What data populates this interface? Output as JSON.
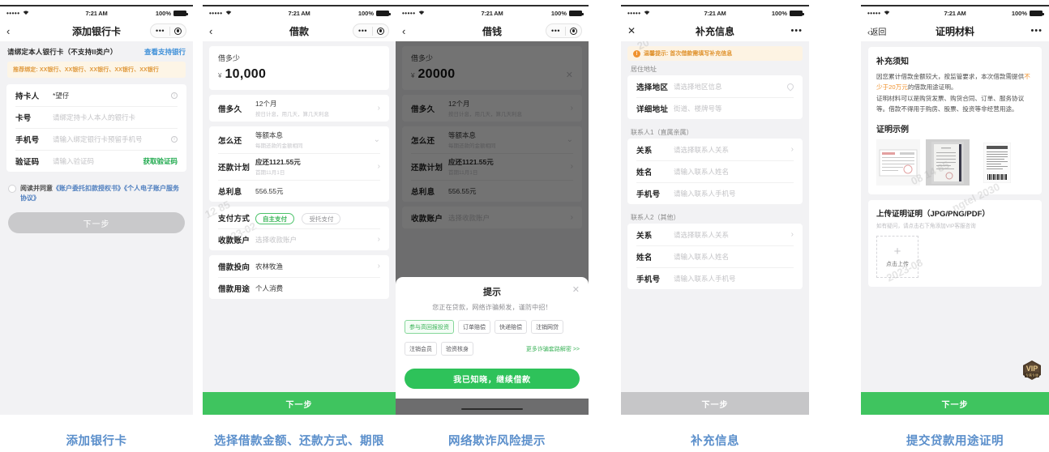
{
  "status_bar": {
    "signal": "•••••",
    "wifi": "◂",
    "time": "7:21 AM",
    "battery": "100%"
  },
  "captions": [
    "添加银行卡",
    "选择借款金额、还款方式、期限",
    "网络欺诈风险提示",
    "补充信息",
    "提交贷款用途证明"
  ],
  "panel1": {
    "nav": {
      "back": "‹",
      "title": "添加银行卡"
    },
    "hint": "请绑定本人银行卡（不支持II类户）",
    "hint_link": "查看支持银行",
    "banner": "推荐绑定: XX银行、XX银行、XX银行、XX银行、XX银行",
    "rows": [
      {
        "label": "持卡人",
        "value": "*望仔",
        "placeholder": false,
        "info": true
      },
      {
        "label": "卡号",
        "value": "请绑定持卡人本人的银行卡",
        "placeholder": true,
        "info": false
      },
      {
        "label": "手机号",
        "value": "请输入绑定银行卡预留手机号",
        "placeholder": true,
        "info": true
      },
      {
        "label": "验证码",
        "value": "请输入验证码",
        "placeholder": true,
        "action": "获取验证码"
      }
    ],
    "agree_prefix": "阅读并同意",
    "agree_link1": "《账户委托扣款授权书》",
    "agree_link2": "《个人电子账户服务协议》",
    "next_button": "下一步"
  },
  "panel2": {
    "nav": {
      "back": "‹",
      "title": "借款"
    },
    "amount_label": "借多少",
    "amount_currency": "¥",
    "amount_value": "10,000",
    "rows": [
      {
        "label": "借多久",
        "main": "12个月",
        "sub": "按日计息，用几天，算几天利息",
        "chev": "›"
      },
      {
        "label": "怎么还",
        "main": "等额本息",
        "sub": "每期还款的金额相同",
        "chev": "⌄"
      },
      {
        "label": "还款计划",
        "main": "应还1121.55元",
        "sub": "首期11月1日",
        "chev": "›",
        "bold": true
      },
      {
        "label": "总利息",
        "main": "556.55元",
        "sub": "",
        "chev": ""
      }
    ],
    "pay_label": "支付方式",
    "pay_options": [
      {
        "text": "自主支付",
        "selected": true
      },
      {
        "text": "受托支付",
        "selected": false
      }
    ],
    "account_label": "收款账户",
    "account_placeholder": "选择收款账户",
    "purpose_rows": [
      {
        "label": "借款投向",
        "value": "农林牧渔",
        "chev": "›"
      },
      {
        "label": "借款用途",
        "value": "个人消费",
        "chev": ""
      }
    ],
    "next_button": "下一步"
  },
  "panel3": {
    "nav": {
      "back": "‹",
      "title": "借钱"
    },
    "amount_label": "借多少",
    "amount_currency": "¥",
    "amount_value": "20000",
    "rows": [
      {
        "label": "借多久",
        "main": "12个月",
        "sub": "按日计息，用几天，算几天利息",
        "chev": "›"
      },
      {
        "label": "怎么还",
        "main": "等额本息",
        "sub": "每期还款的金额相同",
        "chev": "⌄"
      },
      {
        "label": "还款计划",
        "main": "应还1121.55元",
        "sub": "首期11月1日",
        "chev": "›",
        "bold": true
      },
      {
        "label": "总利息",
        "main": "556.55元",
        "sub": "",
        "chev": ""
      }
    ],
    "account_label": "收款账户",
    "account_placeholder": "选择收款账户",
    "modal": {
      "title": "提示",
      "close": "✕",
      "subtitle": "您正在贷款，网络诈骗频发，谨防中招！",
      "tags": [
        {
          "text": "参与高回报投资",
          "highlight": true
        },
        {
          "text": "订单赔偿",
          "highlight": false
        },
        {
          "text": "快递赔偿",
          "highlight": false
        },
        {
          "text": "注销网贷",
          "highlight": false
        },
        {
          "text": "注销会员",
          "highlight": false
        },
        {
          "text": "验资核身",
          "highlight": false
        }
      ],
      "more_link": "更多诈骗套路解密 >>",
      "confirm_button": "我已知晓，继续借款"
    }
  },
  "panel4": {
    "nav": {
      "close": "✕",
      "title": "补充信息",
      "dots": "•••"
    },
    "warning": "温馨提示: 首次借款需填写补充信息",
    "section1_label": "居住地址",
    "section1_rows": [
      {
        "label": "选择地区",
        "placeholder": "请选择地区信息",
        "icon": "location-pin"
      },
      {
        "label": "详细地址",
        "placeholder": "街道、楼牌号等",
        "icon": ""
      }
    ],
    "section2_label": "联系人1（直属亲属）",
    "section2_rows": [
      {
        "label": "关系",
        "placeholder": "请选择联系人关系",
        "chev": "›"
      },
      {
        "label": "姓名",
        "placeholder": "请输入联系人姓名",
        "chev": ""
      },
      {
        "label": "手机号",
        "placeholder": "请输入联系人手机号",
        "chev": ""
      }
    ],
    "section3_label": "联系人2（其他）",
    "section3_rows": [
      {
        "label": "关系",
        "placeholder": "请选择联系人关系",
        "chev": "›"
      },
      {
        "label": "姓名",
        "placeholder": "请输入联系人姓名",
        "chev": ""
      },
      {
        "label": "手机号",
        "placeholder": "请输入联系人手机号",
        "chev": ""
      }
    ],
    "next_button": "下一步"
  },
  "panel5": {
    "nav": {
      "back": "‹返回",
      "title": "证明材料",
      "dots": "•••"
    },
    "notice_title": "补充须知",
    "notice_p1a": "因您累计借款金额较大，按监管要求，本次借款需提供",
    "notice_highlight": "不少于20万元",
    "notice_p1b": "的借款用途证明。",
    "notice_p2": "证明材料可以是购货发票、购货合同、订单、服务协议等。借款不得用于购房、股票、投资等非经营用途。",
    "example_title": "证明示例",
    "upload_title": "上传证明证明（JPG/PNG/PDF）",
    "upload_sub": "如有疑问，请点击右下角添加VIP客服咨询",
    "upload_plus": "+",
    "upload_text": "点击上传",
    "vip_badge": "VIP",
    "vip_badge_sub": "专属专服",
    "next_button": "下一步"
  },
  "colors": {
    "green": "#3fc45f",
    "blue_caption": "#5b8fcb",
    "orange": "#f0922e",
    "grey_disabled": "#c6c6c8"
  }
}
